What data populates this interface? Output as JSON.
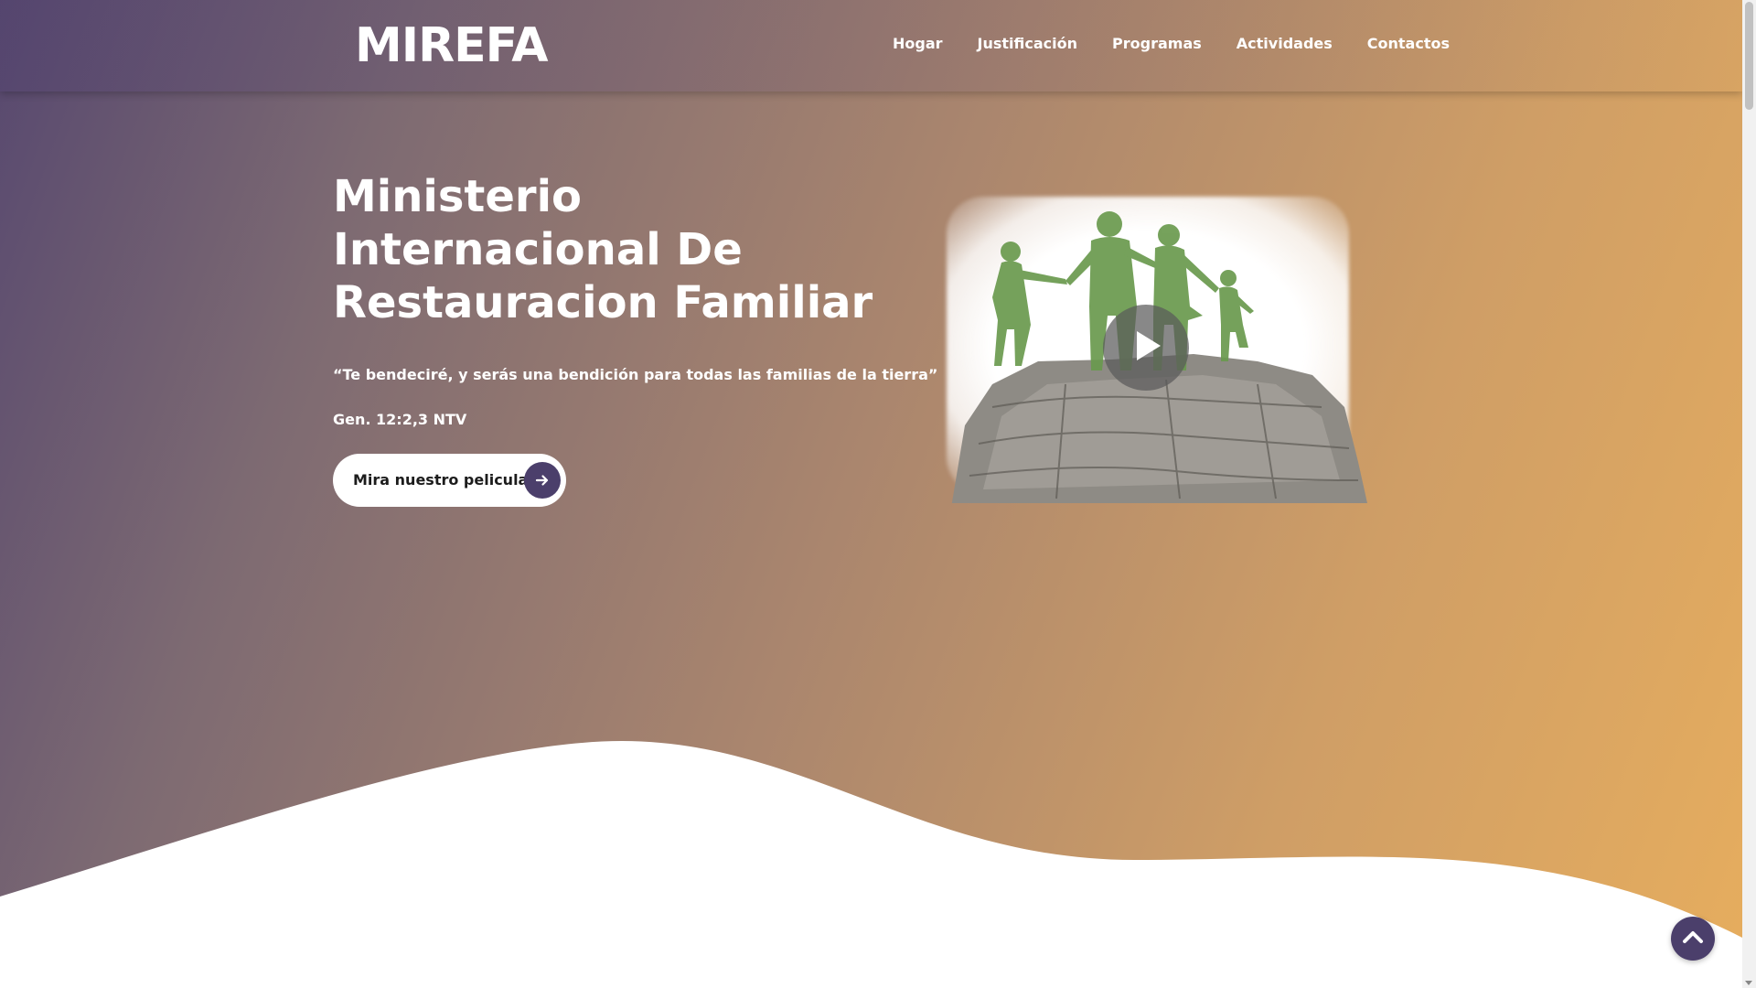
{
  "header": {
    "logo": "MIREFA",
    "nav": [
      {
        "label": "Hogar"
      },
      {
        "label": "Justificación"
      },
      {
        "label": "Programas"
      },
      {
        "label": "Actividades"
      },
      {
        "label": "Contactos"
      }
    ]
  },
  "hero": {
    "title_lines": [
      "Ministerio",
      "Internacional De",
      "Restauracion Familiar"
    ],
    "quote": "“Te bendeciré, y serás una bendición para todas las familias de la tierra”",
    "reference": "Gen. 12:2,3 NTV",
    "cta_label": "Mira nuestro pelicula"
  },
  "icons": {
    "cta": "arrow-right-icon",
    "video": "play-icon",
    "back_to_top": "chevron-up-icon"
  },
  "colors": {
    "gradient_start": "#57486f",
    "gradient_end": "#e6ad5e",
    "accent": "#4b3f6b",
    "silhouette": "#6a9a4e"
  }
}
